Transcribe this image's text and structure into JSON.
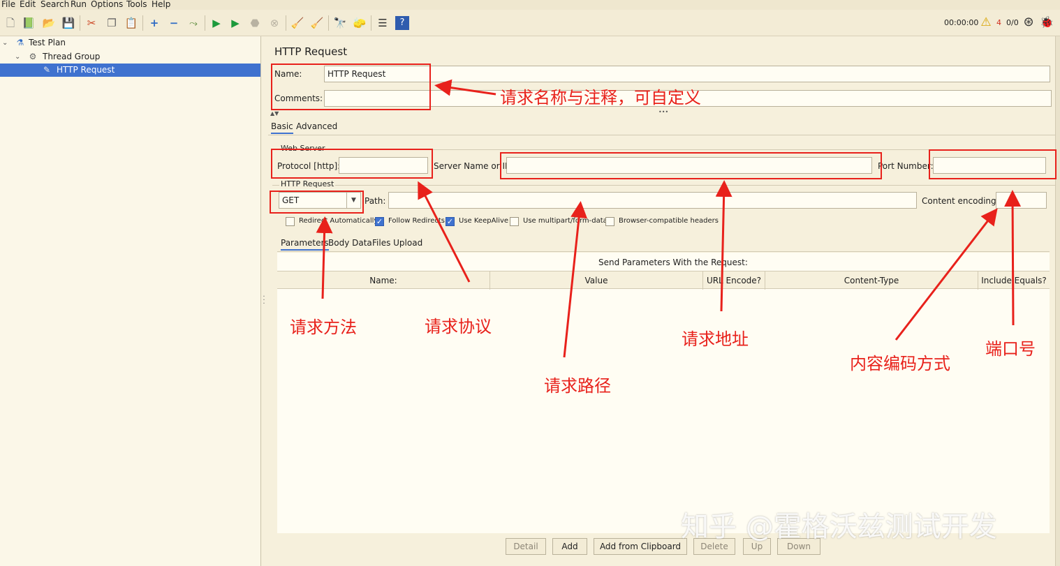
{
  "menu": [
    "File",
    "Edit",
    "Search",
    "Run",
    "Options",
    "Tools",
    "Help"
  ],
  "toolbar": {
    "icons": [
      "new-icon",
      "templates-icon",
      "open-icon",
      "save-icon",
      "cut-icon",
      "copy-icon",
      "paste-icon",
      "expand-icon",
      "collapse-icon",
      "toggle-icon",
      "start-icon",
      "start-no-pause-icon",
      "stop-icon",
      "shutdown-icon",
      "clear-icon",
      "clear-all-icon",
      "search-icon",
      "reset-search-icon",
      "function-helper-icon",
      "help-icon"
    ],
    "timer": "00:00:00",
    "warning_count": "4",
    "threads": "0/0"
  },
  "tree": {
    "items": [
      {
        "label": "Test Plan"
      },
      {
        "label": "Thread Group"
      },
      {
        "label": "HTTP Request"
      }
    ]
  },
  "panel": {
    "title": "HTTP Request",
    "name_label": "Name:",
    "name_value": "HTTP Request",
    "comments_label": "Comments:",
    "comments_value": "",
    "tabs": [
      "Basic",
      "Advanced"
    ],
    "web_server": {
      "section_title": "Web Server",
      "protocol_label": "Protocol [http]:",
      "protocol_value": "",
      "server_label": "Server Name or IP:",
      "server_value": "",
      "port_label": "Port Number:",
      "port_value": ""
    },
    "http_request": {
      "section_title": "HTTP Request",
      "method": "GET",
      "path_label": "Path:",
      "path_value": "",
      "encoding_label": "Content encoding:",
      "encoding_value": ""
    },
    "options": [
      {
        "label": "Redirect Automatically",
        "checked": false
      },
      {
        "label": "Follow Redirects",
        "checked": true
      },
      {
        "label": "Use KeepAlive",
        "checked": true
      },
      {
        "label": "Use multipart/form-data",
        "checked": false
      },
      {
        "label": "Browser-compatible headers",
        "checked": false
      }
    ],
    "sub_tabs": [
      "Parameters",
      "Body Data",
      "Files Upload"
    ],
    "params_caption": "Send Parameters With the Request:",
    "columns": [
      "Name:",
      "Value",
      "URL Encode?",
      "Content-Type",
      "Include Equals?"
    ],
    "buttons": [
      "Detail",
      "Add",
      "Add from Clipboard",
      "Delete",
      "Up",
      "Down"
    ]
  },
  "annotations": {
    "name_comment": "请求名称与注释，可自定义",
    "method": "请求方法",
    "protocol": "请求协议",
    "path": "请求路径",
    "address": "请求地址",
    "encoding": "内容编码方式",
    "port": "端口号"
  },
  "watermark": "知乎 @霍格沃兹测试开发",
  "colors": {
    "annotation": "#e8211b",
    "selection": "#3f72cf",
    "background": "#f6f0dc"
  }
}
